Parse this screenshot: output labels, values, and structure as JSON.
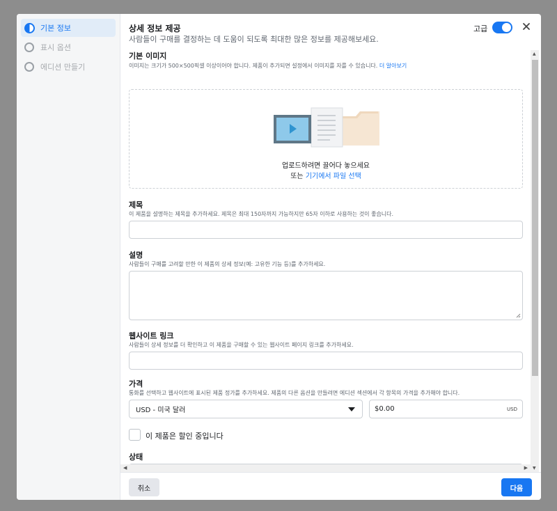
{
  "sidebar": {
    "items": [
      {
        "label": "기본 정보",
        "state": "active"
      },
      {
        "label": "표시 옵션",
        "state": "inactive"
      },
      {
        "label": "에디션 만들기",
        "state": "inactive"
      }
    ]
  },
  "header": {
    "title": "상세 정보 제공",
    "subtitle": "사람들이 구매를 결정하는 데 도움이 되도록 최대한 많은 정보를 제공해보세요.",
    "advanced_label": "고급",
    "advanced_on": true
  },
  "image_section": {
    "label": "기본 이미지",
    "help": "이미지는 크기가 500×500픽셀 이상이어야 합니다. 제품이 추가되면 설정에서 이미지를 자를 수 있습니다.",
    "help_link": "더 알아보기",
    "drop_text": "업로드하려면 끌어다 놓으세요",
    "or_text": "또는",
    "choose_link": "기기에서 파일 선택"
  },
  "title_section": {
    "label": "제목",
    "help": "이 제품을 설명하는 제목을 추가하세요. 제목은 최대 150자까지 가능하지만 65자 이하로 사용하는 것이 좋습니다.",
    "value": ""
  },
  "description_section": {
    "label": "설명",
    "help": "사람들이 구매를 고려할 만한 이 제품의 상세 정보(예: 고유한 기능 등)를 추가하세요.",
    "value": ""
  },
  "website_section": {
    "label": "웹사이트 링크",
    "help": "사람들이 상세 정보를 더 확인하고 이 제품을 구매할 수 있는 웹사이트 페이지 링크를 추가하세요.",
    "value": ""
  },
  "price_section": {
    "label": "가격",
    "help": "통화를 선택하고 웹사이트에 표시된 제품 정가를 추가하세요. 제품의 다른 옵션을 만들려면 에디션 섹션에서 각 항목의 가격을 추가해야 합니다.",
    "currency": "USD - 미국 달러",
    "price_value": "$0.00",
    "currency_code": "USD"
  },
  "sale": {
    "label": "이 제품은 할인 중입니다",
    "checked": false
  },
  "status_section": {
    "label": "상태",
    "value": ""
  },
  "footer": {
    "cancel_label": "취소",
    "next_label": "다음"
  },
  "colors": {
    "accent": "#1877f2",
    "overlay": "#8d8d8d"
  }
}
